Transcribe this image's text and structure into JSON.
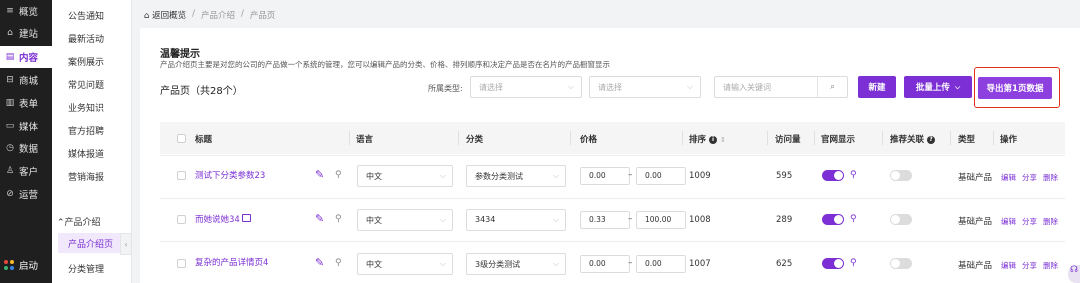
{
  "nav": {
    "items": [
      {
        "icon": "≡",
        "label": "概览"
      },
      {
        "icon": "⌂",
        "label": "建站"
      },
      {
        "icon": "▤",
        "label": "内容"
      },
      {
        "icon": "⊟",
        "label": "商城"
      },
      {
        "icon": "▥",
        "label": "表单"
      },
      {
        "icon": "▭",
        "label": "媒体"
      },
      {
        "icon": "◷",
        "label": "数据"
      },
      {
        "icon": "♙",
        "label": "客户"
      },
      {
        "icon": "⊘",
        "label": "运营"
      }
    ],
    "start_label": "启动"
  },
  "subnav": {
    "items": [
      "公告通知",
      "最新活动",
      "案例展示",
      "常见问题",
      "业务知识",
      "官方招聘",
      "媒体报道",
      "营销海报"
    ],
    "group_label": "产品介绍",
    "active_label": "产品介绍页",
    "next_label": "分类管理",
    "collapse_icon": "‹"
  },
  "breadcrumb": {
    "back": "返回概览",
    "sep": "/",
    "level1": "产品介绍",
    "level2": "产品页"
  },
  "tip": {
    "title": "温馨提示",
    "body": "产品介绍页主要是对您的公司的产品做一个系统的管理，您可以编辑产品的分类、价格、排列顺序和决定产品是否在名片的产品橱窗显示"
  },
  "page_title": "产品页（共28个）",
  "filters": {
    "type_label": "所属类型:",
    "select1_placeholder": "请选择",
    "select2_placeholder": "请选择",
    "search_placeholder": "请输入关键词"
  },
  "buttons": {
    "new": "新建",
    "batch_upload": "批量上传",
    "export": "导出第1页数据"
  },
  "table": {
    "headers": {
      "title": "标题",
      "language": "语言",
      "category": "分类",
      "price": "价格",
      "order": "排序",
      "views": "访问量",
      "site_show": "官网显示",
      "recommend": "推荐关联",
      "type": "类型",
      "ops": "操作"
    },
    "rows": [
      {
        "title": "测试下分类参数23",
        "has_image": false,
        "language": "中文",
        "category": "参数分类测试",
        "price_min": "0.00",
        "price_max": "0.00",
        "order": "1009",
        "views": "595",
        "site_show": true,
        "recommend": false,
        "type": "基础产品"
      },
      {
        "title": "而她说她34",
        "has_image": true,
        "language": "中文",
        "category": "3434",
        "price_min": "0.33",
        "price_max": "100.00",
        "order": "1008",
        "views": "289",
        "site_show": true,
        "recommend": false,
        "type": "基础产品"
      },
      {
        "title": "复杂的产品详情页4",
        "has_image": false,
        "language": "中文",
        "category": "3级分类测试",
        "price_min": "0.00",
        "price_max": "0.00",
        "order": "1007",
        "views": "625",
        "site_show": true,
        "recommend": false,
        "type": "基础产品"
      }
    ],
    "ops": {
      "edit": "编辑",
      "share": "分享",
      "delete": "删除"
    }
  },
  "colors": {
    "accent": "#7b2fd4",
    "highlight": "#e0321b",
    "nav_bg": "#1f1f1f"
  }
}
